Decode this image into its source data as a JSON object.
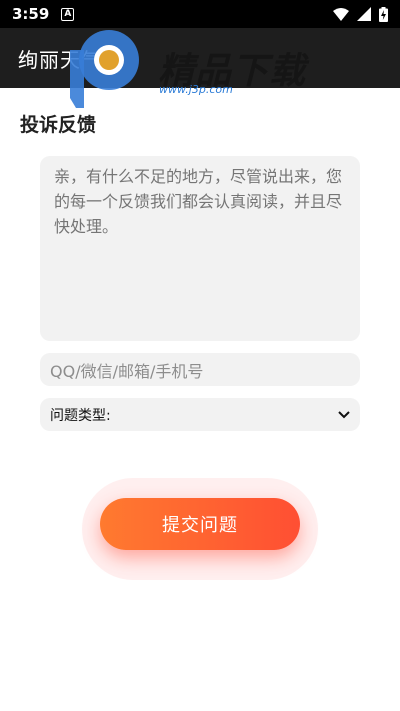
{
  "status_bar": {
    "time": "3:59",
    "notification_glyph": "A",
    "icons": [
      "wifi-icon",
      "signal-icon",
      "battery-charging-icon"
    ]
  },
  "app_bar": {
    "title": "绚丽天气"
  },
  "watermark": {
    "text": "精品下载",
    "url": "www.j3p.com"
  },
  "feedback": {
    "section_title": "投诉反馈",
    "content_placeholder": "亲，有什么不足的地方，尽管说出来，您的每一个反馈我们都会认真阅读，并且尽快处理。",
    "contact_placeholder": "QQ/微信/邮箱/手机号",
    "type_label": "问题类型:",
    "submit_label": "提交问题"
  },
  "colors": {
    "app_bar": "#1e1e1e",
    "field_bg": "#f2f2f2",
    "accent_start": "#ff7a2f",
    "accent_end": "#ff4f33"
  }
}
